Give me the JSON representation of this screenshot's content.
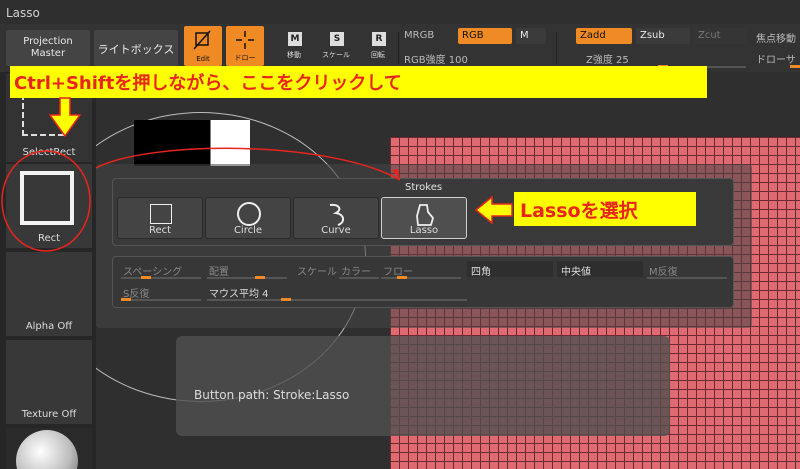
{
  "window": {
    "title": "Lasso"
  },
  "toolbar": {
    "projection_master": "Projection\nMaster",
    "lightbox": "ライトボックス",
    "edit": "Edit",
    "draw": "ドロー",
    "move": "移動",
    "scale": "スケール",
    "rotate": "回転",
    "mrgb": "MRGB",
    "rgb": "RGB",
    "m": "M",
    "rgb_intensity": "RGB強度 100",
    "zadd": "Zadd",
    "zsub": "Zsub",
    "zcut": "Zcut",
    "z_intensity": "Z強度 25",
    "focal_shift": "焦点移動",
    "draw_size": "ドローサ"
  },
  "left_panel": {
    "select_rect": "SelectRect",
    "rect": "Rect",
    "alpha_off": "Alpha Off",
    "texture_off": "Texture Off"
  },
  "strokes_panel": {
    "title": "Strokes",
    "buttons": [
      "Rect",
      "Circle",
      "Curve",
      "Lasso"
    ],
    "selected": "Lasso"
  },
  "stroke_params": {
    "spacing": "スペーシング",
    "placement": "配置",
    "scale": "スケール",
    "color": "カラー",
    "flow": "フロー",
    "square": "四角",
    "median": "中央値",
    "m_invert": "M反復",
    "s_invert": "S反復",
    "mouse_avg": "マウス平均 4"
  },
  "tooltip": {
    "text": "Button path: Stroke:Lasso"
  },
  "annotations": {
    "top": "Ctrl+Shiftを押しながら、ここをクリックして",
    "right": "Lassoを選択"
  },
  "colors": {
    "accent": "#f08a24",
    "annotation_bg": "#ffff00",
    "annotation_text": "#e8251d",
    "mesh": "#e06a72"
  }
}
